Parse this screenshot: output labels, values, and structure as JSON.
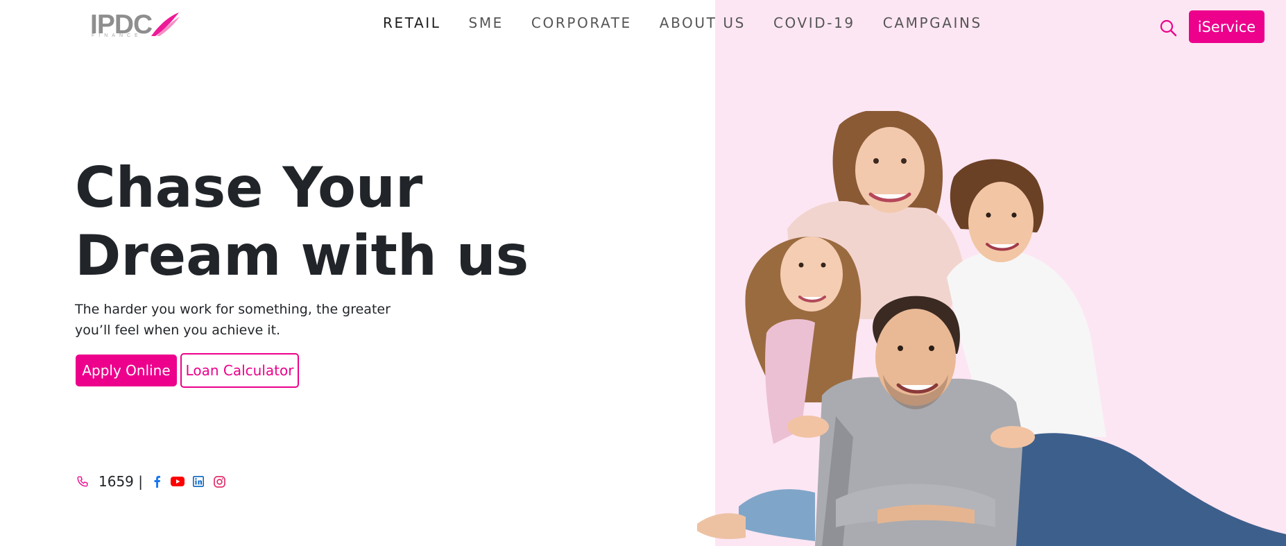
{
  "header": {
    "logo_text": "IPDC",
    "logo_subtext": "FINANCE",
    "nav": [
      {
        "label": "RETAIL",
        "active": true
      },
      {
        "label": "SME"
      },
      {
        "label": "CORPORATE"
      },
      {
        "label": "ABOUT US"
      },
      {
        "label": "COVID-19"
      },
      {
        "label": "CAMPGAINS"
      }
    ],
    "search_icon": "search-icon",
    "iservice_label": "iService"
  },
  "hero": {
    "headline_line1": "Chase Your",
    "headline_line2": "Dream with us",
    "subtext_line1": "The harder you work for something, the greater",
    "subtext_line2": "you’ll feel when you achieve it.",
    "apply_label": "Apply Online",
    "calculator_label": "Loan Calculator"
  },
  "contact": {
    "phone": "1659 |",
    "socials": [
      "facebook-icon",
      "youtube-icon",
      "linkedin-icon",
      "instagram-icon"
    ]
  },
  "colors": {
    "brand": "#ec008c",
    "hero_bg": "#fde6f3",
    "text": "#212529"
  }
}
